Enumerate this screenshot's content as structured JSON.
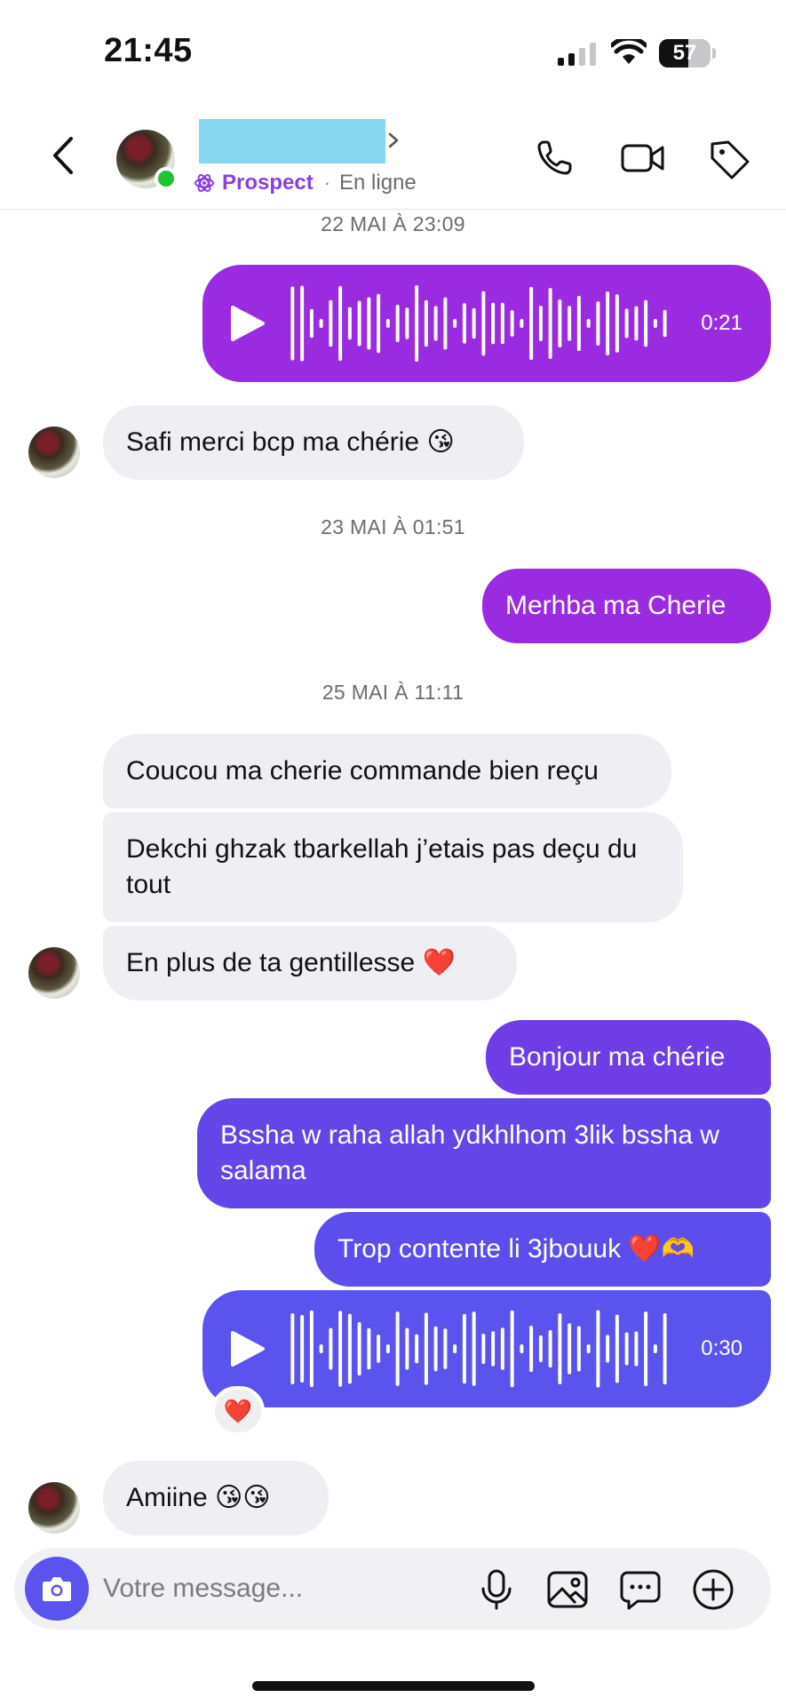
{
  "status_bar": {
    "time": "21:45",
    "battery_level": "57",
    "battery_fraction": 0.57
  },
  "header": {
    "status_tag": "Prospect",
    "separator": "·",
    "presence": "En ligne",
    "back_icon": "chevron-left-icon",
    "icons": [
      "phone-icon",
      "video-camera-icon",
      "tag-icon"
    ]
  },
  "colors": {
    "incoming_bubble": "#efeff3",
    "outgoing_purple": "#9a2be0",
    "outgoing_violet": "#6346e8",
    "accent": "#5a53ee",
    "online": "#1fc233"
  },
  "messages": {
    "ts1": "22 MAI À 23:09",
    "voice1_duration": "0:21",
    "in1": "Safi merci bcp ma chérie 😘",
    "ts2": "23 MAI À 01:51",
    "out1": "Merhba ma Cherie",
    "ts3": "25 MAI À 11:11",
    "in2": "Coucou ma cherie commande bien reçu",
    "in3": "Dekchi ghzak tbarkellah j’etais pas deçu du tout",
    "in4": "En plus de ta gentillesse ❤️",
    "out2": "Bonjour ma chérie",
    "out3": "Bssha w raha allah ydkhlhom 3lik bssha w salama",
    "out4": "Trop contente li 3jbouuk ❤️🫶",
    "voice2_duration": "0:30",
    "voice2_reaction": "❤️",
    "in5": "Amiine 😘😘"
  },
  "composer": {
    "placeholder": "Votre message...",
    "icons": [
      "camera-icon",
      "microphone-icon",
      "image-icon",
      "chat-bubble-icon",
      "plus-circle-icon"
    ]
  }
}
